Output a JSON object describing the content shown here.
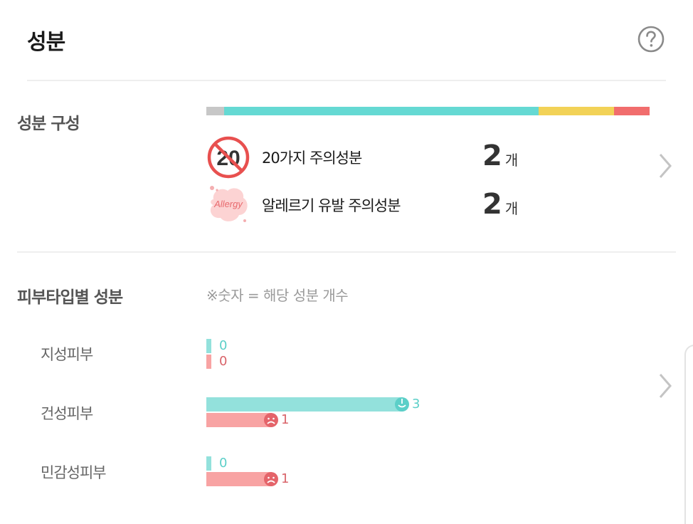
{
  "header": {
    "title": "성분",
    "help_icon": "question-circle-icon"
  },
  "composition": {
    "section_title": "성분 구성",
    "bar_segments": [
      {
        "name": "unknown",
        "fraction": 0.04,
        "color": "#c7c7c7"
      },
      {
        "name": "low",
        "fraction": 0.71,
        "color": "#65d9d3"
      },
      {
        "name": "medium",
        "fraction": 0.17,
        "color": "#f2d257"
      },
      {
        "name": "high",
        "fraction": 0.08,
        "color": "#f16d6d"
      }
    ],
    "warnings": [
      {
        "badge": "20",
        "label": "20가지 주의성분",
        "count": "2",
        "unit": "개"
      },
      {
        "badge": "Allergy",
        "label": "알레르기 유발 주의성분",
        "count": "2",
        "unit": "개"
      }
    ]
  },
  "skin_type": {
    "section_title": "피부타입별 성분",
    "note": "※숫자 = 해당 성분 개수",
    "rows": [
      {
        "label": "지성피부",
        "good": 0,
        "bad": 0
      },
      {
        "label": "건성피부",
        "good": 3,
        "bad": 1
      },
      {
        "label": "민감성피부",
        "good": 0,
        "bad": 1
      }
    ],
    "colors": {
      "good": "#93e1dc",
      "bad": "#f8a3a3"
    }
  }
}
